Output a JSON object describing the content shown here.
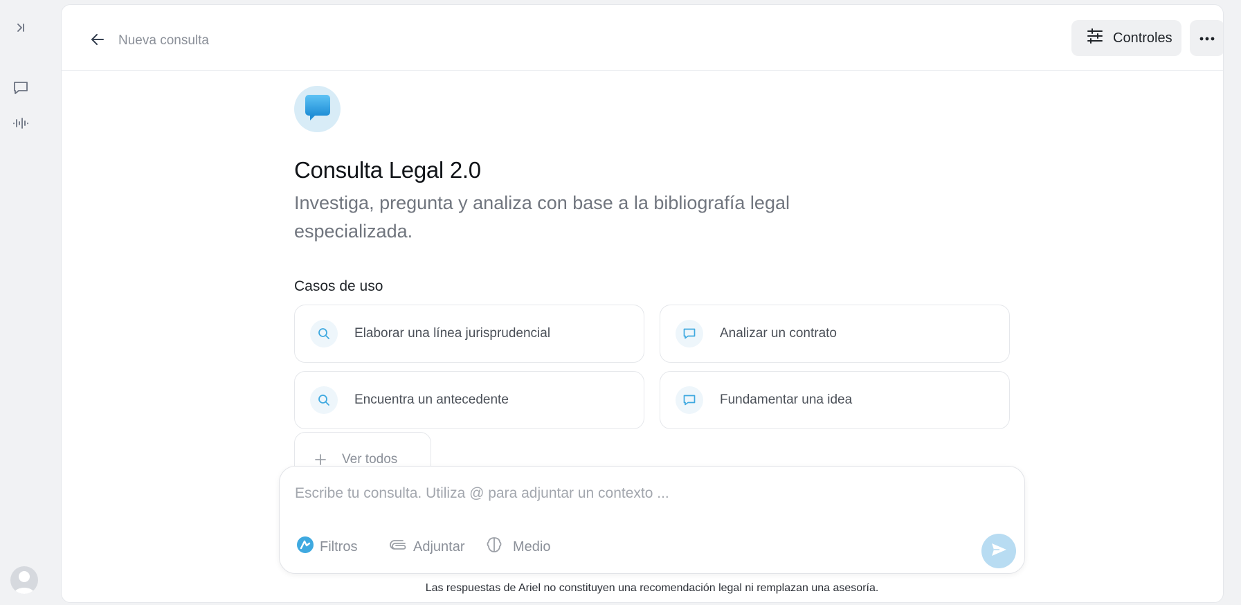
{
  "header": {
    "title": "Nueva consulta",
    "controls_label": "Controles"
  },
  "agent": {
    "title": "Consulta Legal 2.0",
    "subtitle": "Investiga, pregunta y analiza con base a la bibliografía legal especializada."
  },
  "use_cases": {
    "label": "Casos de uso",
    "items": [
      {
        "label": "Elaborar una línea jurisprudencial",
        "icon": "search-icon"
      },
      {
        "label": "Analizar un contrato",
        "icon": "chat-icon"
      },
      {
        "label": "Encuentra un antecedente",
        "icon": "search-icon"
      },
      {
        "label": "Fundamentar una idea",
        "icon": "chat-icon"
      }
    ],
    "see_all_label": "Ver todos"
  },
  "composer": {
    "placeholder": "Escribe tu consulta. Utiliza @ para adjuntar un contexto ...",
    "value": "",
    "tools": {
      "filters": "Filtros",
      "attach": "Adjuntar",
      "mode": "Medio"
    }
  },
  "footer": {
    "disclaimer": "Las respuestas de Ariel no constituyen una recomendación legal ni remplazan una asesoría."
  },
  "colors": {
    "accent": "#3fa9e0",
    "send_button": "#b8dcf2",
    "icon_bubble": "#eef6fb"
  }
}
